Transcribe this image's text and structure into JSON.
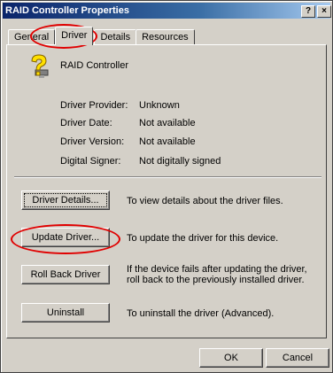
{
  "window": {
    "title": "RAID Controller Properties",
    "help_button": "?",
    "close_button": "×"
  },
  "tabs": [
    "General",
    "Driver",
    "Details",
    "Resources"
  ],
  "active_tab": "Driver",
  "device": {
    "name": "RAID Controller",
    "icon": "unknown-device-icon"
  },
  "properties": [
    {
      "label": "Driver Provider:",
      "value": "Unknown"
    },
    {
      "label": "Driver Date:",
      "value": "Not available"
    },
    {
      "label": "Driver Version:",
      "value": "Not available"
    },
    {
      "label": "Digital Signer:",
      "value": "Not digitally signed"
    }
  ],
  "actions": [
    {
      "button": "Driver Details...",
      "description": "To view details about the driver files."
    },
    {
      "button": "Update Driver...",
      "description": "To update the driver for this device."
    },
    {
      "button": "Roll Back Driver",
      "description": "If the device fails after updating the driver, roll back to the previously installed driver."
    },
    {
      "button": "Uninstall",
      "description": "To uninstall the driver (Advanced)."
    }
  ],
  "footer": {
    "ok_label": "OK",
    "cancel_label": "Cancel"
  },
  "colors": {
    "title_bar": "#0a246a",
    "dialog_face": "#d4d0c8",
    "annotation": "#e00000"
  }
}
